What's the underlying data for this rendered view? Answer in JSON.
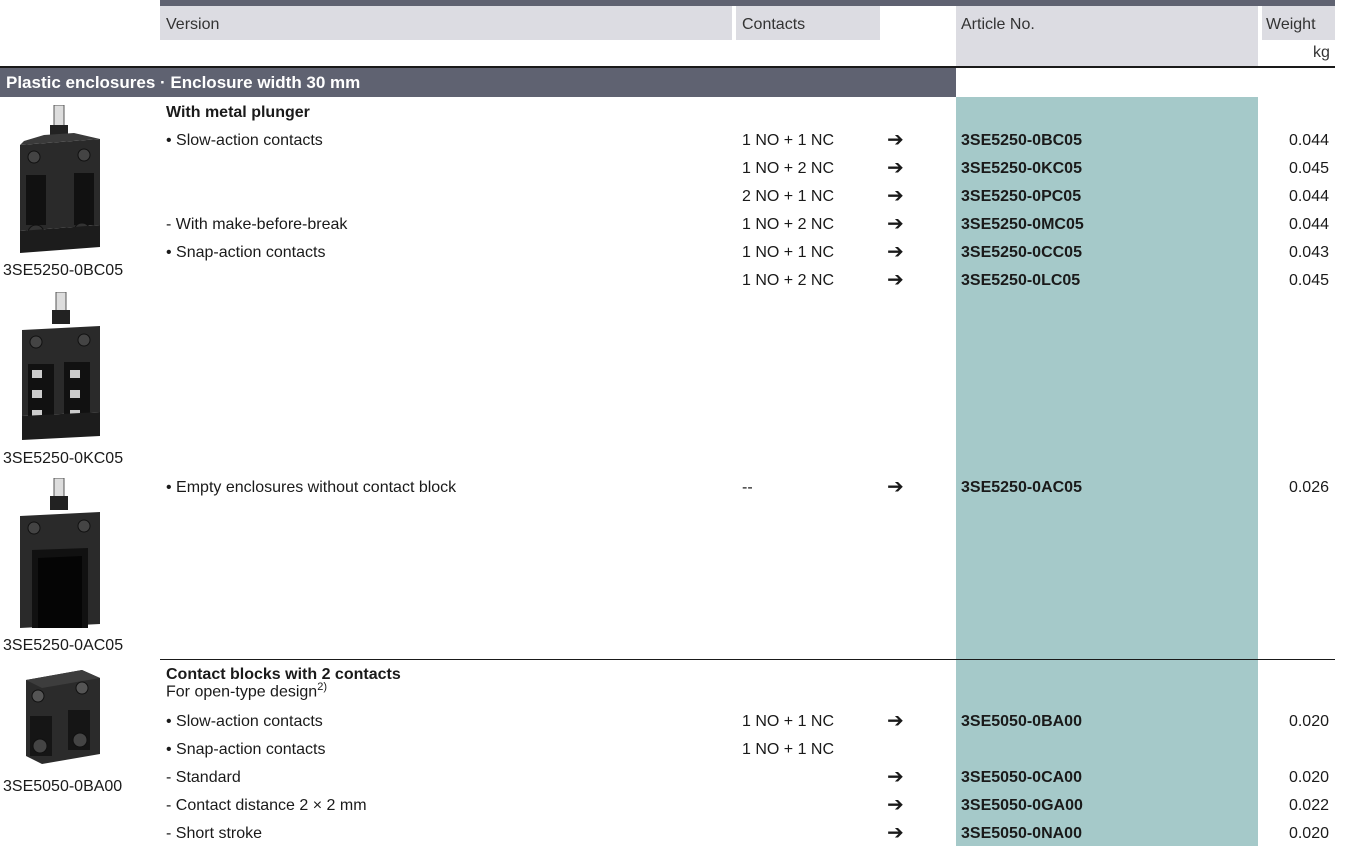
{
  "header": {
    "version": "Version",
    "contacts": "Contacts",
    "article_no": "Article No.",
    "weight": "Weight",
    "weight_unit": "kg"
  },
  "section_title": "Plastic enclosures · Enclosure width 30 mm",
  "images": [
    {
      "caption": "3SE5250-0BC05",
      "icon": "switch-enclosure-icon"
    },
    {
      "caption": "3SE5250-0KC05",
      "icon": "switch-enclosure-contacts-icon"
    },
    {
      "caption": "3SE5250-0AC05",
      "icon": "empty-enclosure-icon"
    },
    {
      "caption": "3SE5050-0BA00",
      "icon": "contact-block-icon"
    }
  ],
  "group1": {
    "title": "With metal plunger",
    "rows": [
      {
        "version": "• Slow-action contacts",
        "contacts": "1 NO + 1 NC",
        "arrow": "➔",
        "article": "3SE5250-0BC05",
        "weight": "0.044"
      },
      {
        "version": "",
        "contacts": "1 NO + 2 NC",
        "arrow": "➔",
        "article": "3SE5250-0KC05",
        "weight": "0.045"
      },
      {
        "version": "",
        "contacts": "2 NO + 1 NC",
        "arrow": "➔",
        "article": "3SE5250-0PC05",
        "weight": "0.044"
      },
      {
        "version": "- With make-before-break",
        "contacts": "1 NO + 2 NC",
        "arrow": "➔",
        "article": "3SE5250-0MC05",
        "weight": "0.044"
      },
      {
        "version": "• Snap-action contacts",
        "contacts": "1 NO + 1 NC",
        "arrow": "➔",
        "article": "3SE5250-0CC05",
        "weight": "0.043"
      },
      {
        "version": "",
        "contacts": "1 NO + 2 NC",
        "arrow": "➔",
        "article": "3SE5250-0LC05",
        "weight": "0.045"
      }
    ],
    "empty_row": {
      "version": "• Empty enclosures without contact block",
      "contacts": "--",
      "arrow": "➔",
      "article": "3SE5250-0AC05",
      "weight": "0.026"
    }
  },
  "group2": {
    "title": "Contact blocks with 2 contacts",
    "subtitle": "For open-type design",
    "footnote": "2)",
    "rows": [
      {
        "version": "• Slow-action contacts",
        "contacts": "1 NO + 1 NC",
        "arrow": "➔",
        "article": "3SE5050-0BA00",
        "weight": "0.020"
      },
      {
        "version": "• Snap-action contacts",
        "contacts": "1 NO + 1 NC",
        "arrow": "",
        "article": "",
        "weight": ""
      },
      {
        "version": "- Standard",
        "contacts": "",
        "arrow": "➔",
        "article": "3SE5050-0CA00",
        "weight": "0.020"
      },
      {
        "version": "- Contact distance 2 × 2 mm",
        "contacts": "",
        "arrow": "➔",
        "article": "3SE5050-0GA00",
        "weight": "0.022"
      },
      {
        "version": "- Short stroke",
        "contacts": "",
        "arrow": "➔",
        "article": "3SE5050-0NA00",
        "weight": "0.020"
      }
    ]
  },
  "colors": {
    "header_bar": "#5f6271",
    "header_bg": "#dcdce2",
    "article_highlight": "#a5c9c9"
  }
}
